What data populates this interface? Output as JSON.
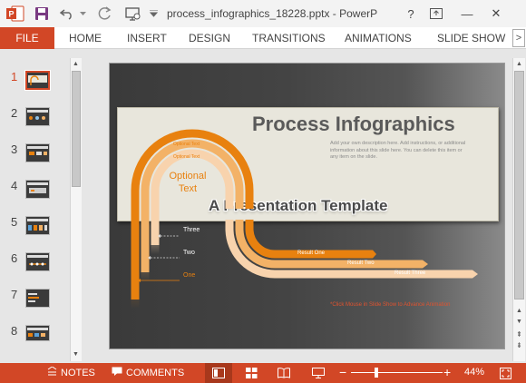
{
  "app": {
    "title": "process_infographics_18228.pptx - PowerP",
    "help_label": "?",
    "minimize_label": "—",
    "close_label": "✕"
  },
  "ribbon": {
    "file_label": "FILE",
    "tabs": [
      {
        "label": "HOME"
      },
      {
        "label": "INSERT"
      },
      {
        "label": "DESIGN"
      },
      {
        "label": "TRANSITIONS"
      },
      {
        "label": "ANIMATIONS"
      },
      {
        "label": "SLIDE SHOW"
      }
    ],
    "more_label": ">"
  },
  "thumbnails": {
    "selected": 1,
    "items": [
      {
        "num": "1"
      },
      {
        "num": "2"
      },
      {
        "num": "3"
      },
      {
        "num": "4"
      },
      {
        "num": "5"
      },
      {
        "num": "6"
      },
      {
        "num": "7"
      },
      {
        "num": "8"
      }
    ]
  },
  "slide": {
    "title": "Process Infographics",
    "description": "Add your own description here. Add instructions, or additional information about this slide here. You can delete this item or any item on the slide.",
    "subtitle": "A Presentation Template",
    "arc_labels": [
      "Optional Text",
      "Optional Text",
      "Optional Text"
    ],
    "center_text": "Optional\nText",
    "steps": [
      "Three",
      "Two",
      "One"
    ],
    "results": [
      "Result One",
      "Result Two",
      "Result Three"
    ],
    "footnote": "*Click Mouse in Slide Show to Advance Animation",
    "colors": {
      "orange": "#e8810f",
      "light_orange": "#f3b267",
      "peach": "#f8d3ad",
      "banner": "#e8e6dc",
      "title_text": "#5a5a5a",
      "red_note": "#e0532f"
    }
  },
  "status": {
    "notes_label": "NOTES",
    "comments_label": "COMMENTS",
    "zoom_level": "44%",
    "zoom_fraction": 0.28,
    "accent": "#d24726"
  }
}
